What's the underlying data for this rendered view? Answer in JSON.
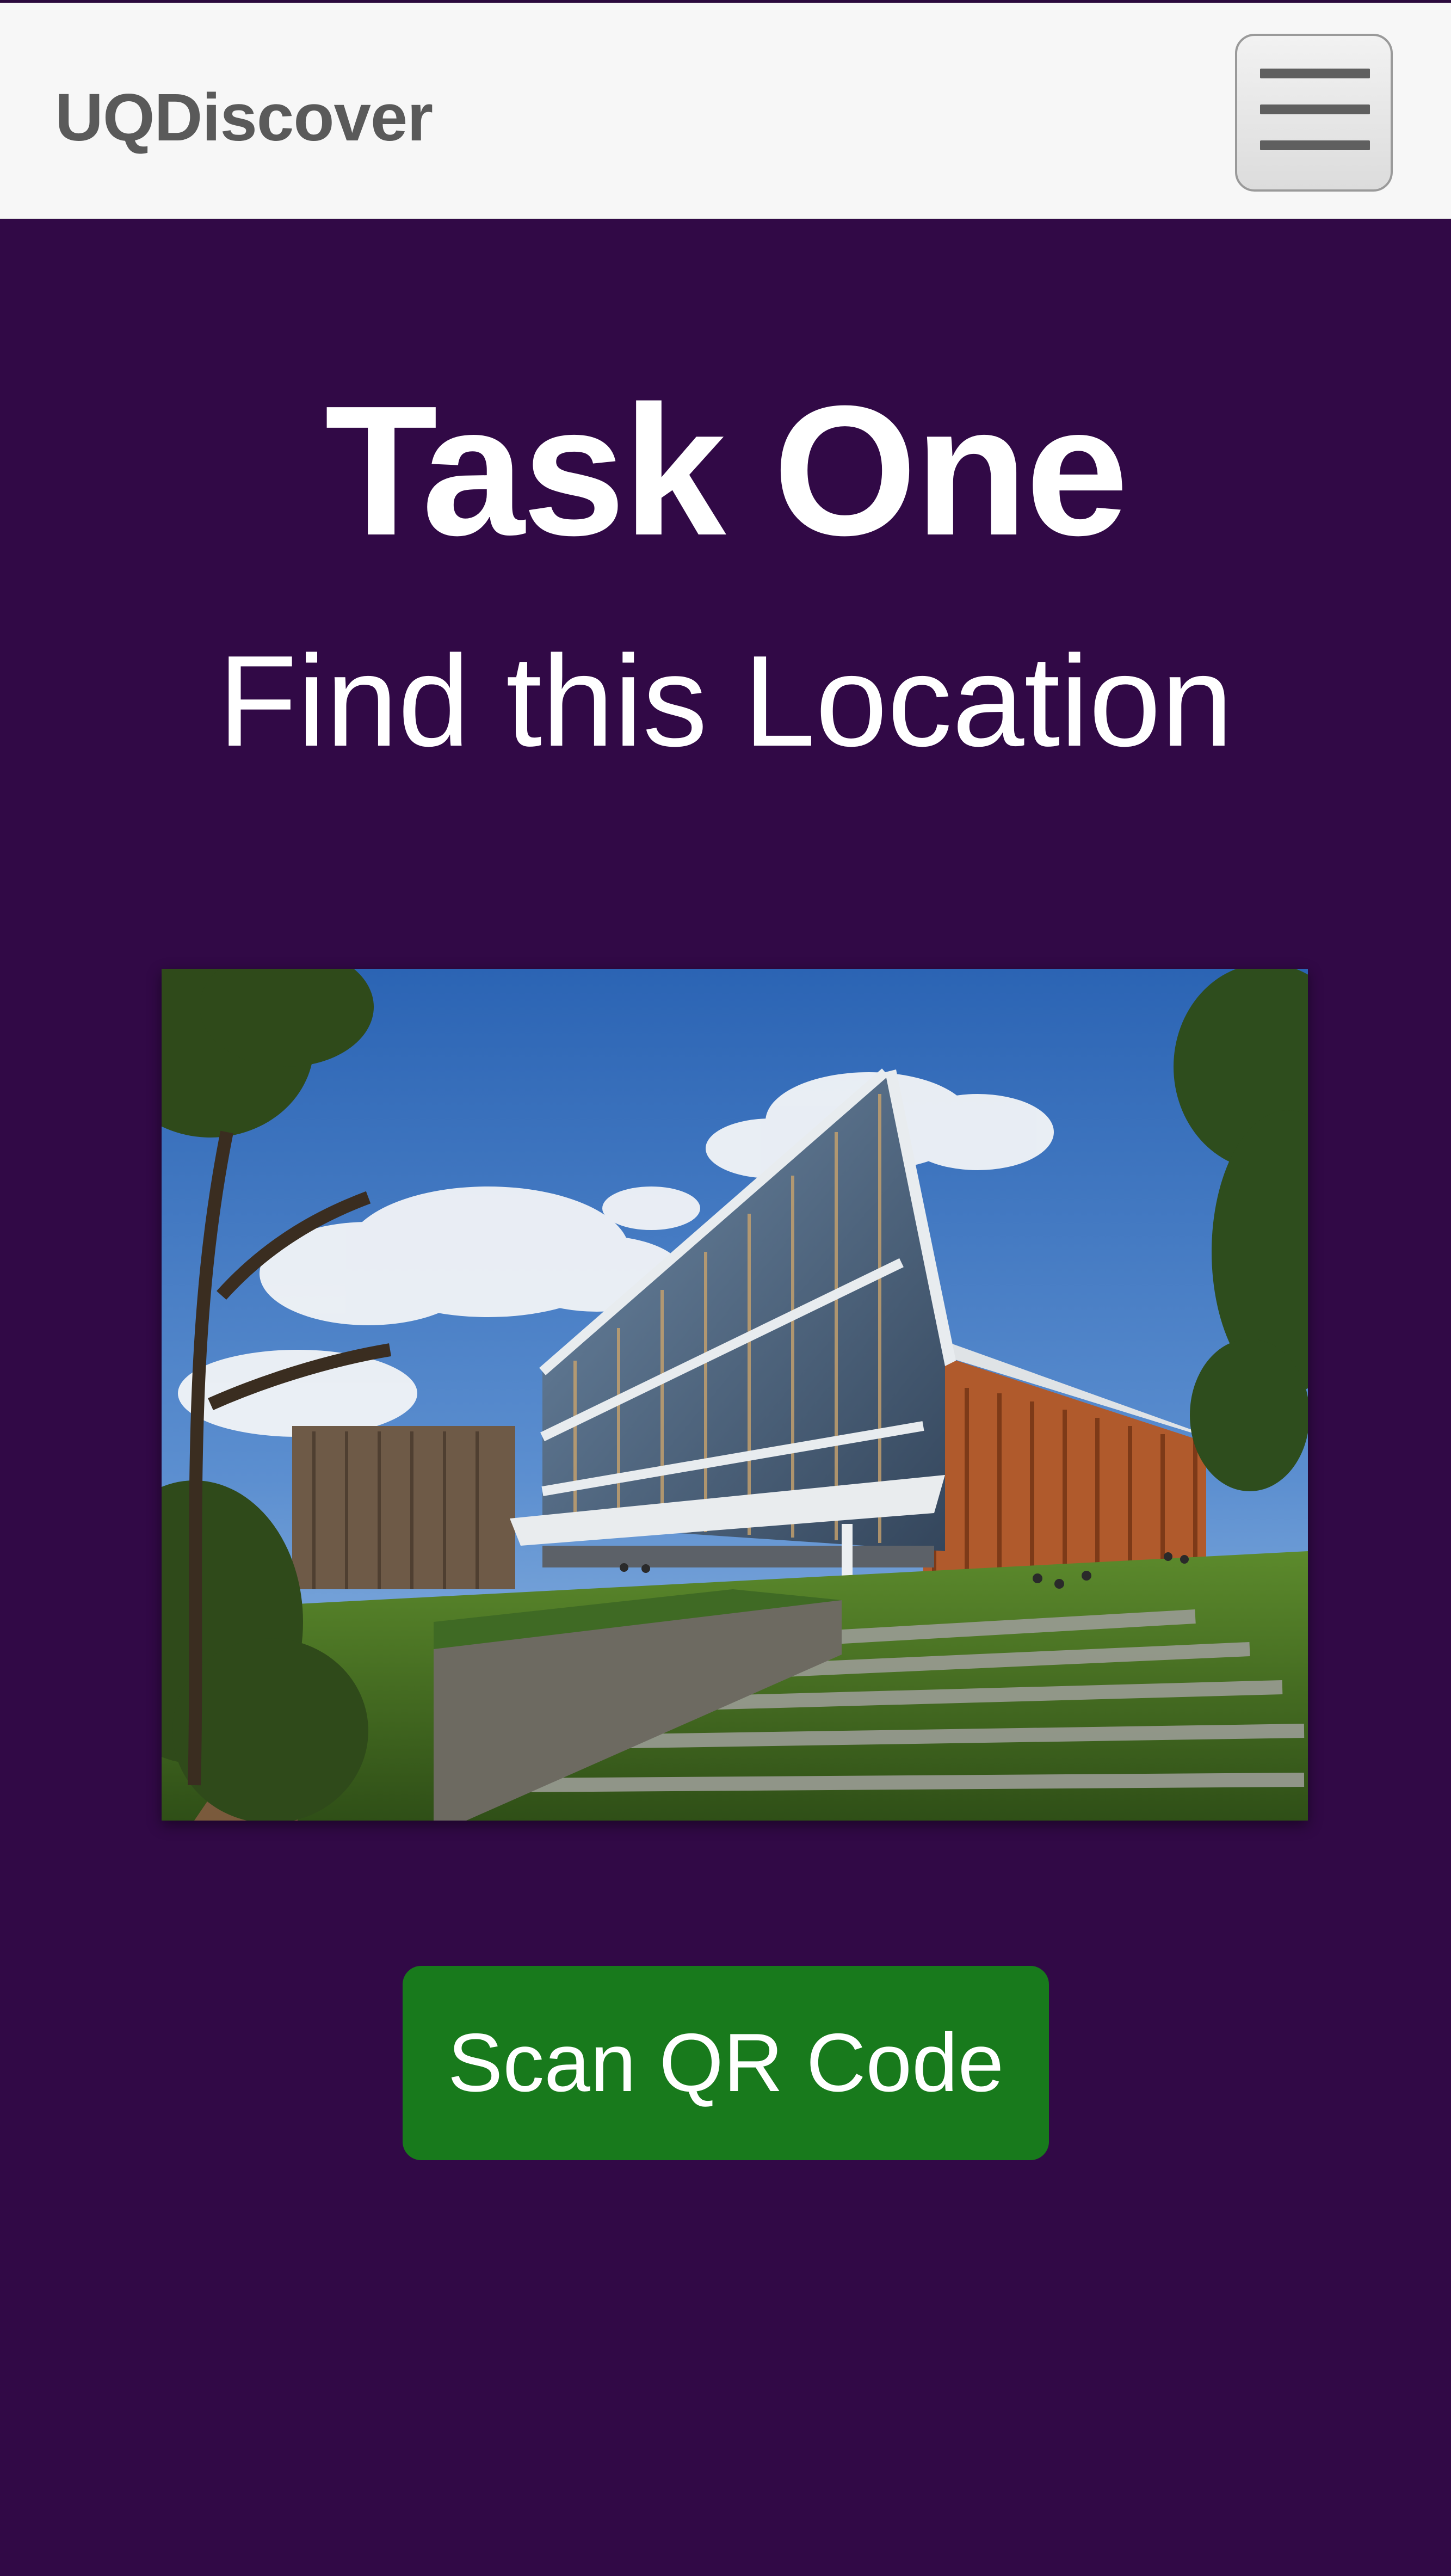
{
  "header": {
    "brand": "UQDiscover",
    "menu_icon": "hamburger-menu-icon"
  },
  "main": {
    "title": "Task One",
    "subtitle": "Find this Location",
    "scan_button_label": "Scan QR Code"
  },
  "colors": {
    "background": "#310946",
    "navbar": "#f7f7f7",
    "brand_text": "#5a5a5a",
    "button": "#187a1c",
    "text": "#ffffff"
  }
}
